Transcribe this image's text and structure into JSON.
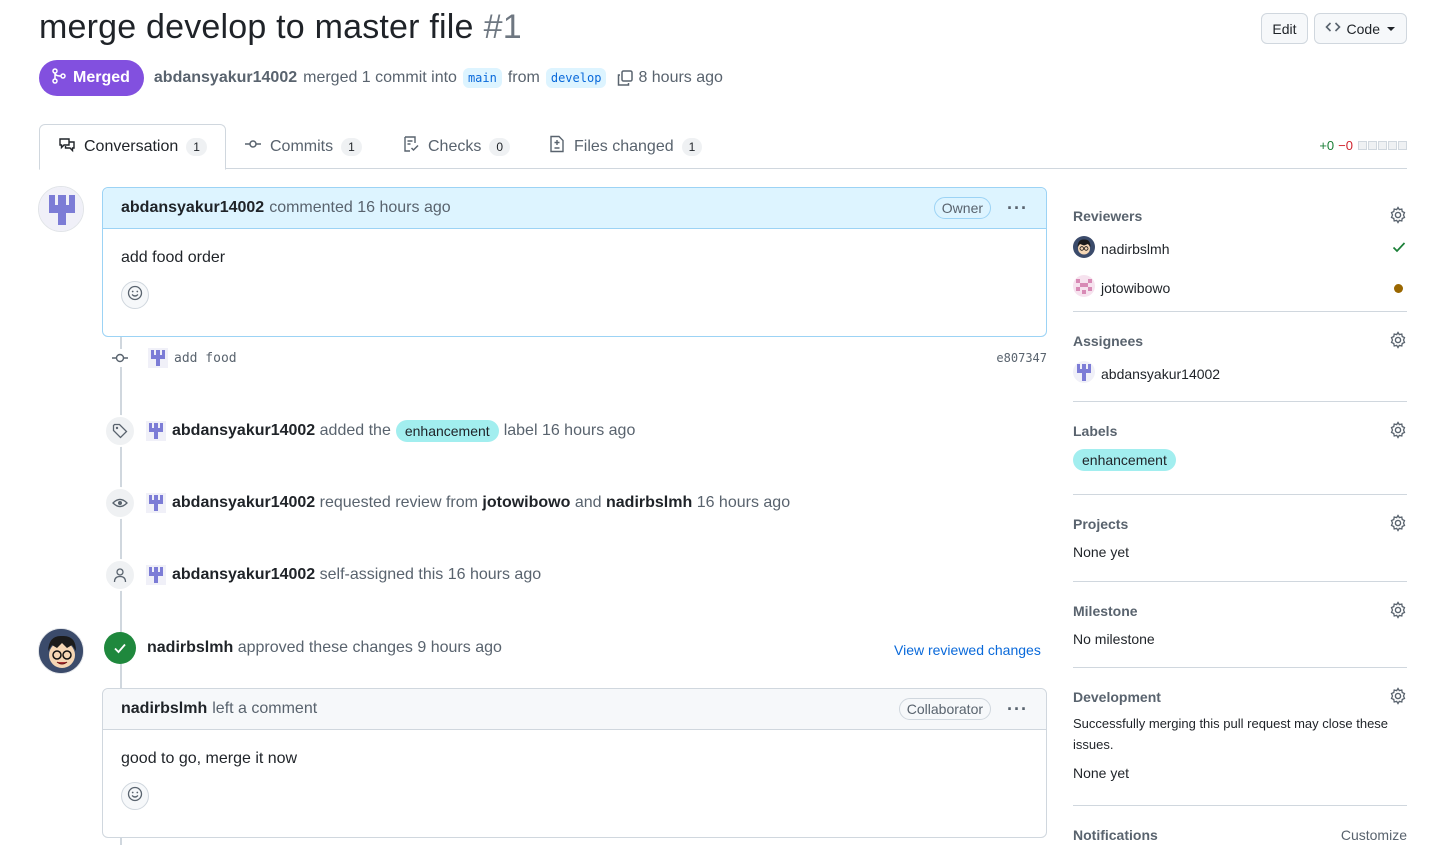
{
  "pr": {
    "title": "merge develop to master file",
    "number": "#1",
    "state": "Merged",
    "author": "abdansyakur14002",
    "action_text": "merged 1 commit into",
    "base_branch": "main",
    "from_text": "from",
    "head_branch": "develop",
    "time": "8 hours ago"
  },
  "header_actions": {
    "edit": "Edit",
    "code": "Code"
  },
  "tabs": [
    {
      "label": "Conversation",
      "count": "1"
    },
    {
      "label": "Commits",
      "count": "1"
    },
    {
      "label": "Checks",
      "count": "0"
    },
    {
      "label": "Files changed",
      "count": "1"
    }
  ],
  "diffstat": {
    "additions": "+0",
    "deletions": "−0"
  },
  "timeline": {
    "first_comment": {
      "author": "abdansyakur14002",
      "meta": "commented 16 hours ago",
      "role": "Owner",
      "body": "add food order"
    },
    "commit": {
      "message": "add food",
      "sha": "e807347"
    },
    "label_event": {
      "actor": "abdansyakur14002",
      "pre": "added the",
      "label": "enhancement",
      "post": "label 16 hours ago"
    },
    "review_request": {
      "actor": "abdansyakur14002",
      "pre": "requested review from",
      "reviewer1": "jotowibowo",
      "and": "and",
      "reviewer2": "nadirbslmh",
      "time": "16 hours ago"
    },
    "assign_event": {
      "actor": "abdansyakur14002",
      "text": "self-assigned this 16 hours ago"
    },
    "approval": {
      "actor": "nadirbslmh",
      "text": "approved these changes 9 hours ago",
      "link": "View reviewed changes"
    },
    "second_comment": {
      "author": "nadirbslmh",
      "meta": "left a comment",
      "role": "Collaborator",
      "body": "good to go, merge it now"
    }
  },
  "sidebar": {
    "reviewers": {
      "title": "Reviewers",
      "items": [
        {
          "name": "nadirbslmh",
          "status": "approved"
        },
        {
          "name": "jotowibowo",
          "status": "pending"
        }
      ]
    },
    "assignees": {
      "title": "Assignees",
      "items": [
        "abdansyakur14002"
      ]
    },
    "labels": {
      "title": "Labels",
      "items": [
        "enhancement"
      ]
    },
    "projects": {
      "title": "Projects",
      "value": "None yet"
    },
    "milestone": {
      "title": "Milestone",
      "value": "No milestone"
    },
    "development": {
      "title": "Development",
      "note": "Successfully merging this pull request may close these issues.",
      "value": "None yet"
    },
    "notifications": {
      "title": "Notifications",
      "action": "Customize"
    }
  },
  "colors": {
    "merged": "#8250df",
    "label_enhancement": "#a2eeef",
    "approved": "#1f883d",
    "link": "#0969da"
  }
}
